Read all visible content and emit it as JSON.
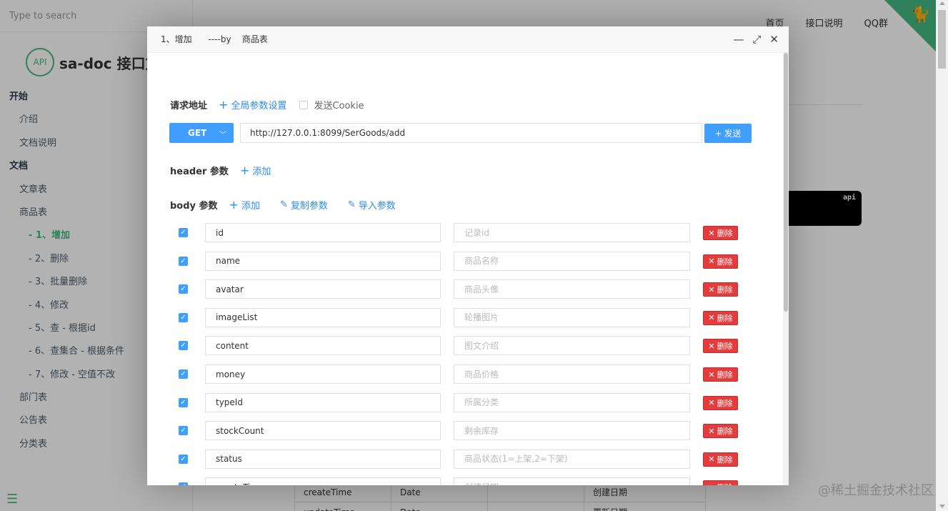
{
  "search": {
    "placeholder": "Type to search"
  },
  "logo": {
    "badge": "API",
    "title": "sa-doc 接口文"
  },
  "sidebar": {
    "items": [
      {
        "label": "开始",
        "level": "group"
      },
      {
        "label": "介绍",
        "level": "l1"
      },
      {
        "label": "文档说明",
        "level": "l1"
      },
      {
        "label": "文档",
        "level": "group"
      },
      {
        "label": "文章表",
        "level": "l1"
      },
      {
        "label": "商品表",
        "level": "l1"
      },
      {
        "label": "- 1、增加",
        "level": "l2",
        "active": true
      },
      {
        "label": "- 2、删除",
        "level": "l2"
      },
      {
        "label": "- 3、批量删除",
        "level": "l2"
      },
      {
        "label": "- 4、修改",
        "level": "l2"
      },
      {
        "label": "- 5、查 - 根据id",
        "level": "l2"
      },
      {
        "label": "- 6、查集合 - 根据条件",
        "level": "l2"
      },
      {
        "label": "- 7、修改 - 空值不改",
        "level": "l2"
      },
      {
        "label": "部门表",
        "level": "l1"
      },
      {
        "label": "公告表",
        "level": "l1"
      },
      {
        "label": "分类表",
        "level": "l1"
      }
    ]
  },
  "topnav": {
    "home": "首页",
    "api_doc": "接口说明",
    "qq": "QQ群"
  },
  "code_label": "api",
  "bg_table": [
    [
      "createTime",
      "Date",
      "",
      "创建日期"
    ],
    [
      "updateTime",
      "Date",
      "",
      "更新日期"
    ]
  ],
  "watermark": "@稀土掘金技术社区",
  "modal": {
    "title": "1、增加      ----by    商品表",
    "request_url_label": "请求地址",
    "global_params_label": "全局参数设置",
    "send_cookie_label": "发送Cookie",
    "method": "GET",
    "url": "http://127.0.0.1:8099/SerGoods/add",
    "send_label": "发送",
    "header_label": "header 参数",
    "header_add": "添加",
    "body_label": "body 参数",
    "body_add": "添加",
    "copy_params": "复制参数",
    "import_params": "导入参数",
    "delete_label": "删除",
    "params": [
      {
        "name": "id",
        "placeholder": "记录id"
      },
      {
        "name": "name",
        "placeholder": "商品名称"
      },
      {
        "name": "avatar",
        "placeholder": "商品头像"
      },
      {
        "name": "imageList",
        "placeholder": "轮播图片"
      },
      {
        "name": "content",
        "placeholder": "图文介绍"
      },
      {
        "name": "money",
        "placeholder": "商品价格"
      },
      {
        "name": "typeId",
        "placeholder": "所属分类"
      },
      {
        "name": "stockCount",
        "placeholder": "剩余库存"
      },
      {
        "name": "status",
        "placeholder": "商品状态(1=上架,2=下架)"
      },
      {
        "name": "createTime",
        "placeholder": "创建日期"
      },
      {
        "name": "",
        "placeholder": ""
      }
    ]
  },
  "colors": {
    "accent": "#42b983",
    "primary": "#409eff",
    "danger": "#e23c3c"
  }
}
